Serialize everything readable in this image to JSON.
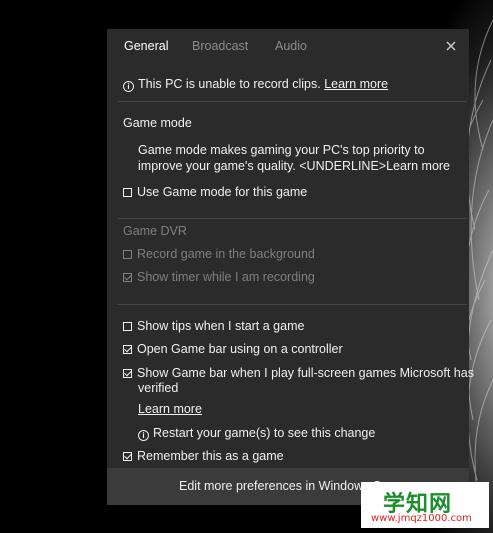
{
  "tabs": [
    {
      "label": "General",
      "active": true
    },
    {
      "label": "Broadcast",
      "active": false
    },
    {
      "label": "Audio",
      "active": false
    }
  ],
  "notice": {
    "text": "This PC is unable to record clips. ",
    "link": "Learn more"
  },
  "game_mode": {
    "heading": "Game mode",
    "description_line1": "Game mode makes gaming your PC's top priority to",
    "description_line2": "improve your game's quality. <UNDERLINE>Learn more",
    "checkbox_label": "Use Game mode for this game",
    "checkbox_checked": false
  },
  "game_dvr": {
    "heading": "Game DVR",
    "record_label": "Record game in the background",
    "record_checked": false,
    "timer_label": "Show timer while I am recording",
    "timer_checked": true
  },
  "options": {
    "tips_label": "Show tips when I start a game",
    "tips_checked": false,
    "controller_label": "Open Game bar using  on a controller",
    "controller_checked": true,
    "fullscreen_line1": "Show Game bar when I play full-screen games Microsoft has",
    "fullscreen_line2": "verified",
    "fullscreen_checked": true,
    "learn_more": "Learn more",
    "restart_note": "Restart your game(s) to see this change",
    "remember_label": "Remember this as a game",
    "remember_checked": true
  },
  "footer": {
    "label": "Edit more preferences in Windows Se"
  },
  "watermark": {
    "top": "学知网",
    "bottom": "www.jmqz1000.com"
  },
  "colors": {
    "panel": "#2b2b2b",
    "footer": "#3b3b3b",
    "dim_text": "#7f7f7f"
  }
}
